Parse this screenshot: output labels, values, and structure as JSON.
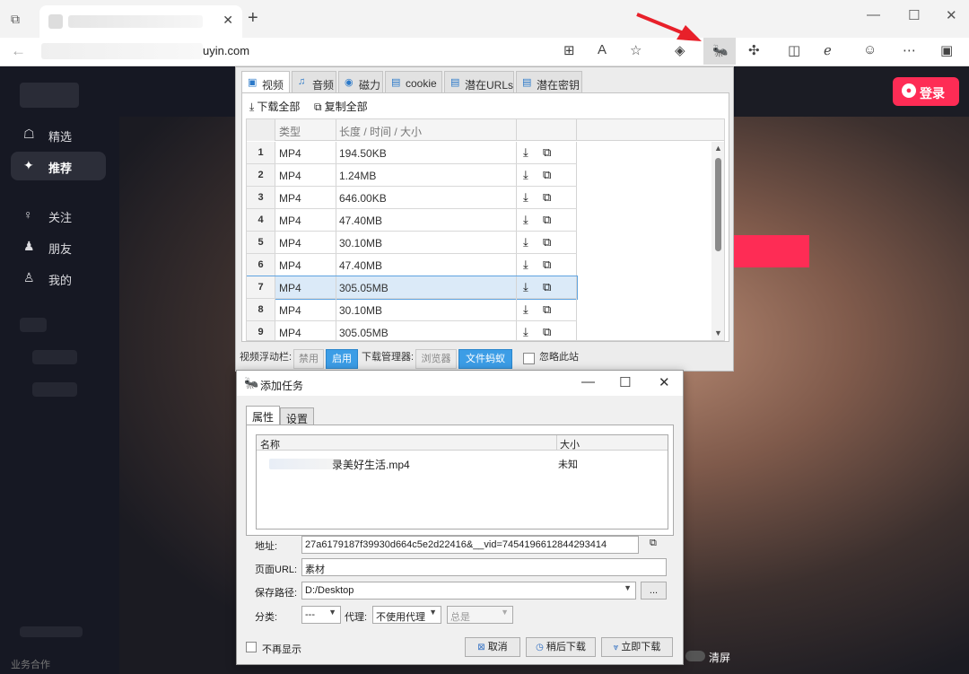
{
  "browser": {
    "url_suffix": "uyin.com",
    "icons": {
      "tabs": "tab-actions-icon",
      "close_tab": "✕",
      "new_tab": "+",
      "min": "—",
      "max": "☐",
      "close": "✕",
      "back": "←"
    }
  },
  "site": {
    "nav": [
      {
        "label": "精选",
        "icon": "☖"
      },
      {
        "label": "推荐",
        "icon": "✦"
      },
      {
        "label": "关注",
        "icon": "♀"
      },
      {
        "label": "朋友",
        "icon": "♟"
      },
      {
        "label": "我的",
        "icon": "♙"
      }
    ],
    "login_label": "登录",
    "bottom_text": "业务合作",
    "clear_label": "清屏",
    "accent": "#fe2c55"
  },
  "popup": {
    "tabs": [
      {
        "label": "视频",
        "icon": "▣"
      },
      {
        "label": "音频",
        "icon": "♫"
      },
      {
        "label": "磁力",
        "icon": "◉"
      },
      {
        "label": "cookie",
        "icon": "▤"
      },
      {
        "label": "潜在URLs",
        "icon": "▤"
      },
      {
        "label": "潜在密钥",
        "icon": "▤"
      }
    ],
    "download_all": "下载全部",
    "copy_all": "复制全部",
    "columns": [
      "类型",
      "长度 / 时间 / 大小"
    ],
    "rows": [
      {
        "num": "1",
        "type": "MP4",
        "size": "194.50KB"
      },
      {
        "num": "2",
        "type": "MP4",
        "size": "1.24MB"
      },
      {
        "num": "3",
        "type": "MP4",
        "size": "646.00KB"
      },
      {
        "num": "4",
        "type": "MP4",
        "size": "47.40MB"
      },
      {
        "num": "5",
        "type": "MP4",
        "size": "30.10MB"
      },
      {
        "num": "6",
        "type": "MP4",
        "size": "47.40MB"
      },
      {
        "num": "7",
        "type": "MP4",
        "size": "305.05MB"
      },
      {
        "num": "8",
        "type": "MP4",
        "size": "30.10MB"
      },
      {
        "num": "9",
        "type": "MP4",
        "size": "305.05MB"
      }
    ],
    "selected_row": 7,
    "footer": {
      "float_label": "视频浮动栏:",
      "disable": "禁用",
      "enable": "启用",
      "dm_label": "下载管理器:",
      "browser": "浏览器",
      "ant": "文件蚂蚁",
      "ignore_site": "忽略此站"
    }
  },
  "dialog": {
    "title": "添加任务",
    "tabs": [
      "属性",
      "设置"
    ],
    "columns": [
      "名称",
      "大小"
    ],
    "file_name": "录美好生活.mp4",
    "file_size": "未知",
    "address_label": "地址:",
    "address": "27a6179187f39930d664c5e2d22416&__vid=7454196612844293414",
    "page_url_label": "页面URL:",
    "page_url": "素材",
    "save_path_label": "保存路径:",
    "save_path": "D:/Desktop",
    "browse": "...",
    "category_label": "分类:",
    "category": "---",
    "proxy_label": "代理:",
    "proxy": "不使用代理",
    "proxy_mode": "总是",
    "no_show": "不再显示",
    "cancel": "取消",
    "later": "稍后下载",
    "now": "立即下载"
  }
}
